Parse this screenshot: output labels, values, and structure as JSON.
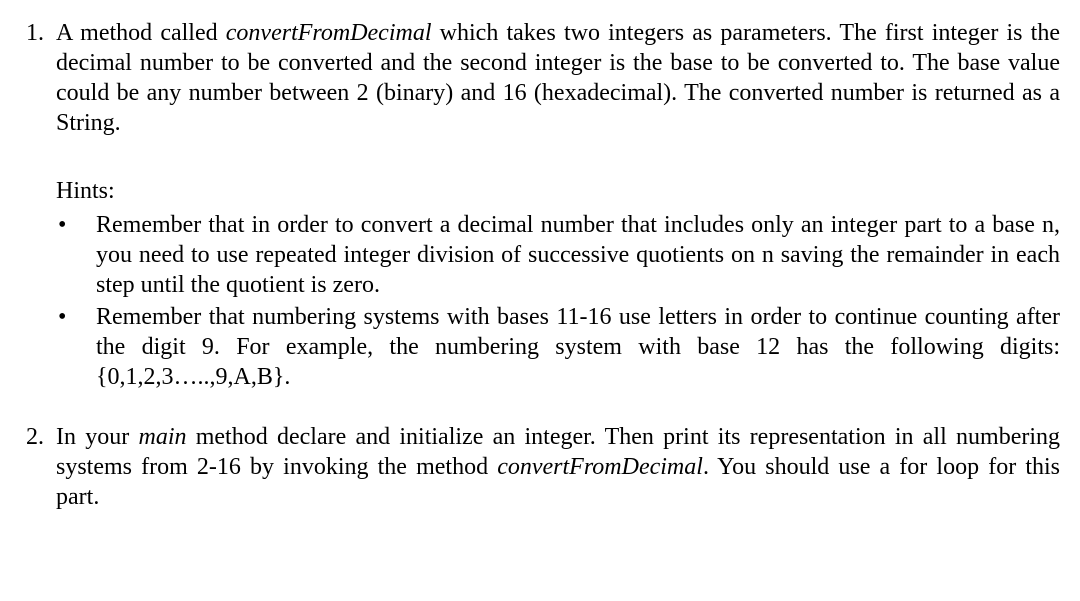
{
  "items": [
    {
      "number": "1.",
      "text_pre": "A method called ",
      "method_name": "convertFromDecimal",
      "text_post": " which takes two integers as parameters. The first integer is the decimal number to be converted and the second integer is the base to be converted to. The base value could be any number between 2 (binary) and 16 (hexadecimal). The converted number is returned as a String.",
      "hints_label": "Hints:",
      "bullets": [
        "Remember that in order to convert a decimal number that includes only an integer part to a base n, you need to use repeated integer division of successive quotients on n saving the remainder in each step until the quotient is zero.",
        "Remember that numbering systems with bases 11-16 use letters in order to continue counting after the digit 9. For example, the numbering system with base 12 has the following digits: {0,1,2,3…..,9,A,B}."
      ]
    },
    {
      "number": "2.",
      "text_pre": "In your ",
      "italic_word": "main",
      "text_mid": " method declare and initialize an integer. Then print its representation in all numbering systems from 2-16 by invoking the method ",
      "method_name": "convertFromDecimal",
      "text_post": ". You should use a for loop for this part."
    }
  ],
  "bullet_char": "•"
}
